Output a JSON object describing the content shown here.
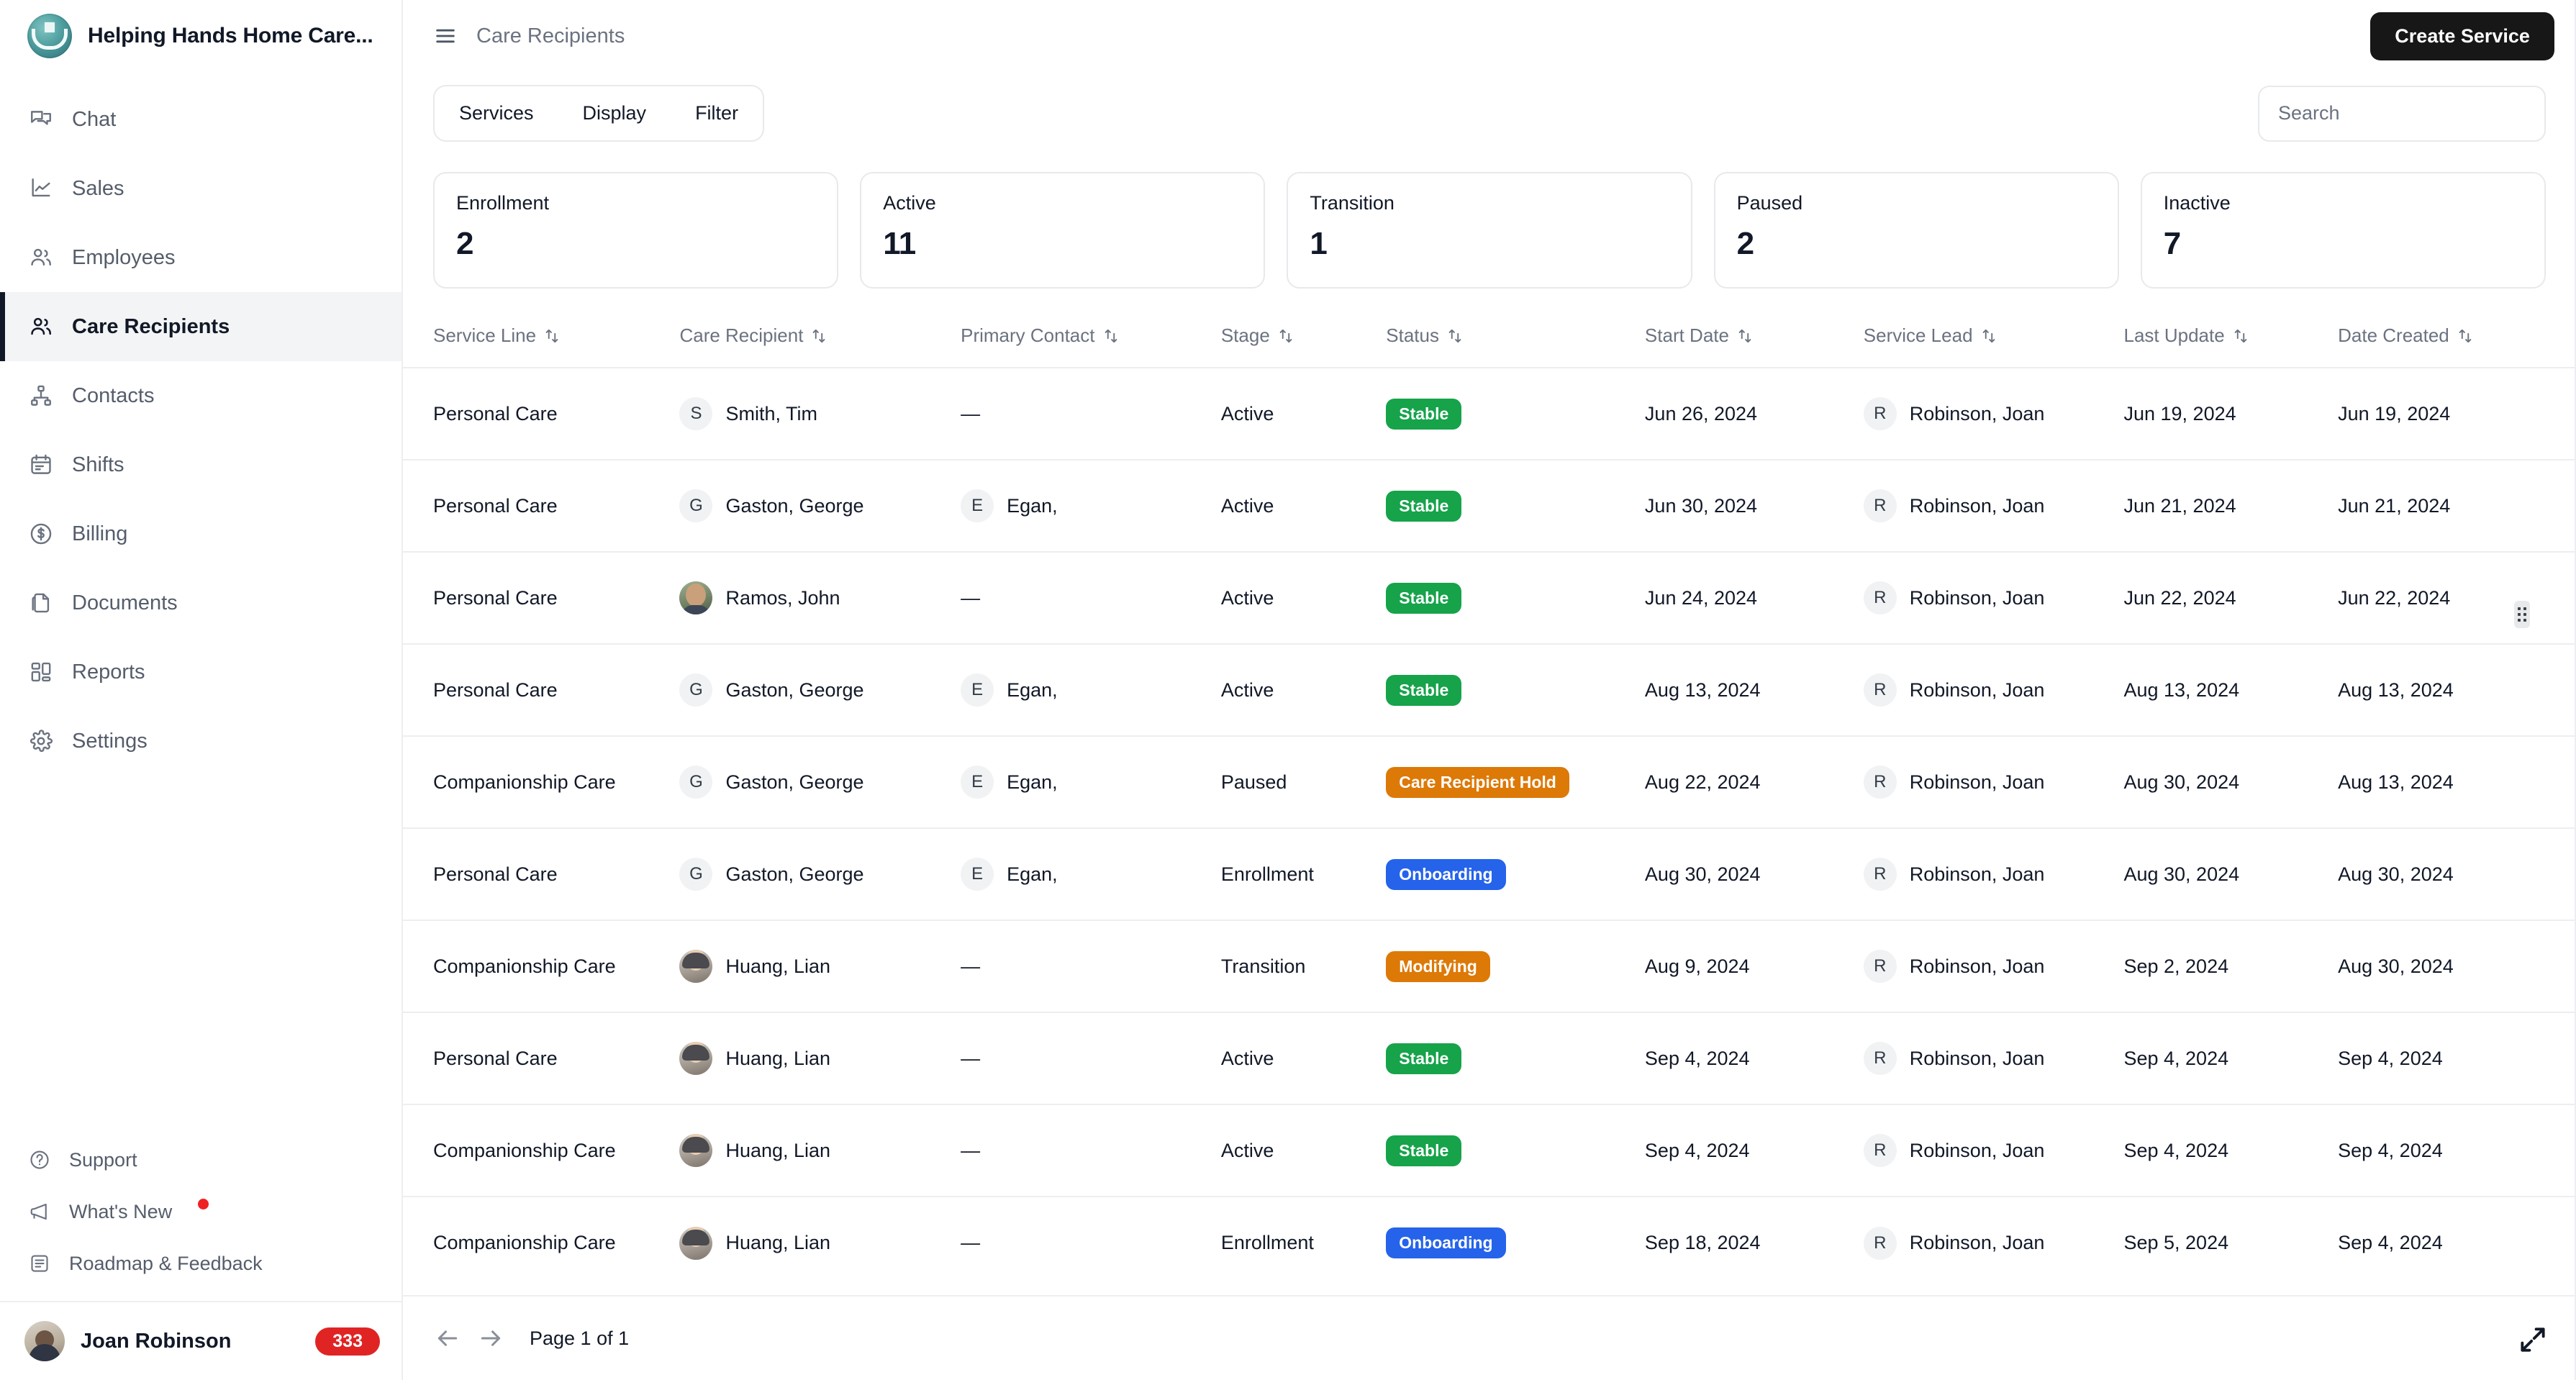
{
  "sidebar": {
    "brand": {
      "title": "Helping Hands Home Care...",
      "logo_icon": "helping-hands-logo"
    },
    "items": [
      {
        "label": "Chat",
        "icon": "chat-icon"
      },
      {
        "label": "Sales",
        "icon": "line-chart-icon"
      },
      {
        "label": "Employees",
        "icon": "users-icon"
      },
      {
        "label": "Care Recipients",
        "icon": "users-icon"
      },
      {
        "label": "Contacts",
        "icon": "org-chart-icon"
      },
      {
        "label": "Shifts",
        "icon": "calendar-icon"
      },
      {
        "label": "Billing",
        "icon": "dollar-circle-icon"
      },
      {
        "label": "Documents",
        "icon": "documents-icon"
      },
      {
        "label": "Reports",
        "icon": "dashboard-grid-icon"
      },
      {
        "label": "Settings",
        "icon": "gear-icon"
      }
    ],
    "bottom_items": [
      {
        "label": "Support",
        "icon": "question-circle-icon",
        "dot": false
      },
      {
        "label": "What's New",
        "icon": "megaphone-icon",
        "dot": true
      },
      {
        "label": "Roadmap & Feedback",
        "icon": "list-document-icon",
        "dot": false
      }
    ],
    "user": {
      "name": "Joan Robinson",
      "badge": "333",
      "avatar_icon": "user-avatar"
    }
  },
  "topbar": {
    "menu_icon": "hamburger-icon",
    "breadcrumb": "Care Recipients",
    "create_button": "Create Service"
  },
  "toolbar": {
    "tabs": [
      "Services",
      "Display",
      "Filter"
    ],
    "search_placeholder": "Search",
    "search_value": ""
  },
  "stats": [
    {
      "label": "Enrollment",
      "value": "2"
    },
    {
      "label": "Active",
      "value": "11"
    },
    {
      "label": "Transition",
      "value": "1"
    },
    {
      "label": "Paused",
      "value": "2"
    },
    {
      "label": "Inactive",
      "value": "7"
    }
  ],
  "table": {
    "columns": [
      "Service Line",
      "Care Recipient",
      "Primary Contact",
      "Stage",
      "Status",
      "Start Date",
      "Service Lead",
      "Last Update",
      "Date Created"
    ],
    "sort_icon": "sort-updown-icon",
    "rows": [
      {
        "service_line": "Personal Care",
        "recipient": "Smith, Tim",
        "recipient_initial": "S",
        "recipient_avatar": "initial",
        "contact": "—",
        "contact_initial": "",
        "stage": "Active",
        "status": "Stable",
        "status_color": "#16a34a",
        "start_date": "Jun 26, 2024",
        "lead": "Robinson, Joan",
        "lead_initial": "R",
        "last_update": "Jun 19, 2024",
        "date_created": "Jun 19, 2024"
      },
      {
        "service_line": "Personal Care",
        "recipient": "Gaston, George",
        "recipient_initial": "G",
        "recipient_avatar": "initial",
        "contact": "Egan,",
        "contact_initial": "E",
        "stage": "Active",
        "status": "Stable",
        "status_color": "#16a34a",
        "start_date": "Jun 30, 2024",
        "lead": "Robinson, Joan",
        "lead_initial": "R",
        "last_update": "Jun 21, 2024",
        "date_created": "Jun 21, 2024"
      },
      {
        "service_line": "Personal Care",
        "recipient": "Ramos, John",
        "recipient_initial": "",
        "recipient_avatar": "photo-man",
        "contact": "—",
        "contact_initial": "",
        "stage": "Active",
        "status": "Stable",
        "status_color": "#16a34a",
        "start_date": "Jun 24, 2024",
        "lead": "Robinson, Joan",
        "lead_initial": "R",
        "last_update": "Jun 22, 2024",
        "date_created": "Jun 22, 2024"
      },
      {
        "service_line": "Personal Care",
        "recipient": "Gaston, George",
        "recipient_initial": "G",
        "recipient_avatar": "initial",
        "contact": "Egan,",
        "contact_initial": "E",
        "stage": "Active",
        "status": "Stable",
        "status_color": "#16a34a",
        "start_date": "Aug 13, 2024",
        "lead": "Robinson, Joan",
        "lead_initial": "R",
        "last_update": "Aug 13, 2024",
        "date_created": "Aug 13, 2024"
      },
      {
        "service_line": "Companionship Care",
        "recipient": "Gaston, George",
        "recipient_initial": "G",
        "recipient_avatar": "initial",
        "contact": "Egan,",
        "contact_initial": "E",
        "stage": "Paused",
        "status": "Care Recipient Hold",
        "status_color": "#dd7907",
        "start_date": "Aug 22, 2024",
        "lead": "Robinson, Joan",
        "lead_initial": "R",
        "last_update": "Aug 30, 2024",
        "date_created": "Aug 13, 2024"
      },
      {
        "service_line": "Personal Care",
        "recipient": "Gaston, George",
        "recipient_initial": "G",
        "recipient_avatar": "initial",
        "contact": "Egan,",
        "contact_initial": "E",
        "stage": "Enrollment",
        "status": "Onboarding",
        "status_color": "#2563eb",
        "start_date": "Aug 30, 2024",
        "lead": "Robinson, Joan",
        "lead_initial": "R",
        "last_update": "Aug 30, 2024",
        "date_created": "Aug 30, 2024"
      },
      {
        "service_line": "Companionship Care",
        "recipient": "Huang, Lian",
        "recipient_initial": "",
        "recipient_avatar": "photo-asian",
        "contact": "—",
        "contact_initial": "",
        "stage": "Transition",
        "status": "Modifying",
        "status_color": "#dd7907",
        "start_date": "Aug 9, 2024",
        "lead": "Robinson, Joan",
        "lead_initial": "R",
        "last_update": "Sep 2, 2024",
        "date_created": "Aug 30, 2024"
      },
      {
        "service_line": "Personal Care",
        "recipient": "Huang, Lian",
        "recipient_initial": "",
        "recipient_avatar": "photo-asian",
        "contact": "—",
        "contact_initial": "",
        "stage": "Active",
        "status": "Stable",
        "status_color": "#16a34a",
        "start_date": "Sep 4, 2024",
        "lead": "Robinson, Joan",
        "lead_initial": "R",
        "last_update": "Sep 4, 2024",
        "date_created": "Sep 4, 2024"
      },
      {
        "service_line": "Companionship Care",
        "recipient": "Huang, Lian",
        "recipient_initial": "",
        "recipient_avatar": "photo-asian",
        "contact": "—",
        "contact_initial": "",
        "stage": "Active",
        "status": "Stable",
        "status_color": "#16a34a",
        "start_date": "Sep 4, 2024",
        "lead": "Robinson, Joan",
        "lead_initial": "R",
        "last_update": "Sep 4, 2024",
        "date_created": "Sep 4, 2024"
      },
      {
        "service_line": "Companionship Care",
        "recipient": "Huang, Lian",
        "recipient_initial": "",
        "recipient_avatar": "photo-asian",
        "contact": "—",
        "contact_initial": "",
        "stage": "Enrollment",
        "status": "Onboarding",
        "status_color": "#2563eb",
        "start_date": "Sep 18, 2024",
        "lead": "Robinson, Joan",
        "lead_initial": "R",
        "last_update": "Sep 5, 2024",
        "date_created": "Sep 4, 2024"
      }
    ]
  },
  "footer": {
    "prev_icon": "arrow-left-icon",
    "next_icon": "arrow-right-icon",
    "page_text": "Page 1 of 1",
    "expand_icon": "expand-diagonal-icon"
  }
}
